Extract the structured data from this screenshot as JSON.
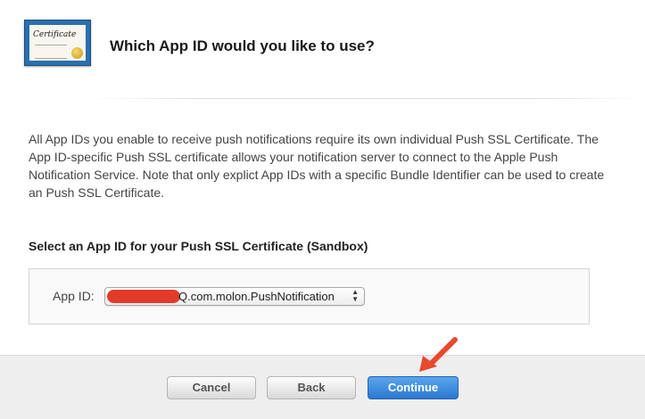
{
  "header": {
    "icon": "certificate-icon",
    "icon_text": "Certificate",
    "title": "Which App ID would you like to use?"
  },
  "description": "All App IDs you enable to receive push notifications require its own individual Push SSL Certificate. The App ID-specific Push SSL certificate allows your notification server to connect to the Apple Push Notification Service. Note that only explict App IDs with a specific Bundle Identifier can be used to create an Push SSL Certificate.",
  "section_label": "Select an App ID for your Push SSL Certificate (Sandbox)",
  "app_id": {
    "label": "App ID:",
    "selected_value": "Q.com.molon.PushNotification",
    "redaction_color": "#e23b2b"
  },
  "buttons": {
    "cancel": "Cancel",
    "back": "Back",
    "continue": "Continue"
  },
  "colors": {
    "primary_button": "#2b78d0",
    "annotation_arrow": "#e8492f"
  }
}
